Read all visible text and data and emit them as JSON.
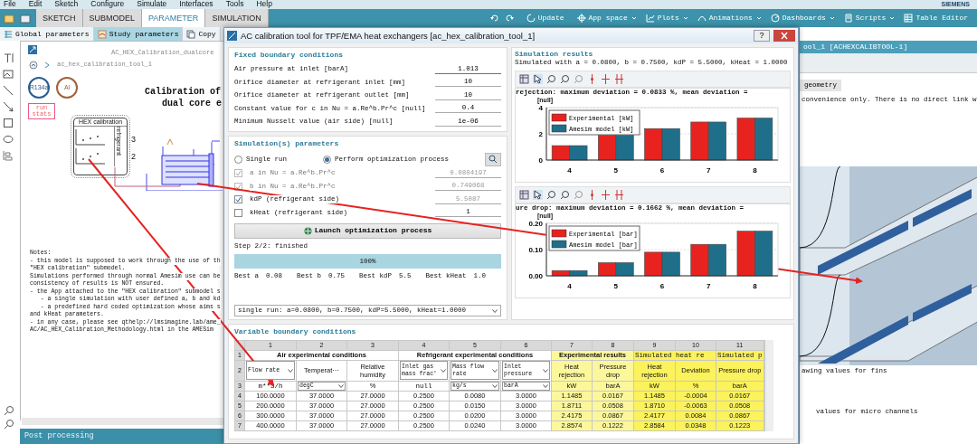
{
  "menu": [
    "File",
    "Edit",
    "Sketch",
    "Configure",
    "Simulate",
    "Interfaces",
    "Tools",
    "Help"
  ],
  "brand": "SIEMENS",
  "toolbar": {
    "tabs": [
      {
        "label": "SKETCH",
        "selected": false
      },
      {
        "label": "SUBMODEL",
        "selected": false
      },
      {
        "label": "PARAMETER",
        "selected": true
      },
      {
        "label": "SIMULATION",
        "selected": false
      }
    ],
    "actions": [
      {
        "label": "Update",
        "kind": "update"
      },
      {
        "label": "App space",
        "kind": "app"
      },
      {
        "label": "Plots",
        "kind": "plots"
      },
      {
        "label": "Animations",
        "kind": "anim"
      },
      {
        "label": "Dashboards",
        "kind": "dash"
      },
      {
        "label": "Scripts",
        "kind": "scripts"
      },
      {
        "label": "Table Editor",
        "kind": "table"
      }
    ]
  },
  "left_panel": {
    "tabs": [
      {
        "label": "Global parameters",
        "selected": false
      },
      {
        "label": "Study parameters",
        "selected": true
      },
      {
        "label": "Copy",
        "selected": false
      }
    ],
    "sketch_title": "AC_HEX_Calibration_dualcore",
    "breadcrumb": "ac_hex_calibration_tool_1",
    "badges": [
      {
        "label": "R134a",
        "color": "#2a5d8f"
      },
      {
        "label": "Al",
        "color": "#a0623a"
      }
    ],
    "run_stats": "run stats",
    "diagram_title": [
      "Calibration of",
      "dual core e"
    ],
    "block": {
      "title": "HEX calibration",
      "side_label": "refrigerant",
      "ports": [
        "3",
        "2"
      ]
    },
    "notes": [
      "Notes:",
      "- this model is supposed to work through the use of th",
      "\"HEX calibration\" submodel.",
      "Simulations performed through normal Amesim use can be",
      "consistency of results is NOT ensured.",
      "- the App attached to the \"HEX calibration\" submodel s",
      "   - a single simulation with user defined a, b and kd",
      "   - a predefined hard coded optimization whose aims s",
      "and kHeat parameters.",
      "- in any case, please see qthelp://lmsimagine.lab/ame_",
      "AC/AC_HEX_Calibration_Methodology.html in the AMESim"
    ],
    "bottom_bar": "Post processing"
  },
  "dialog": {
    "title": "AC calibration tool for TPF/EMA heat exchangers [ac_hex_calibration_tool_1]",
    "help": "?",
    "fixed": {
      "heading": "Fixed boundary conditions",
      "rows": [
        {
          "label": "Air pressure at inlet [barA]",
          "value": "1.013"
        },
        {
          "label": "Orifice diameter at refrigerant inlet [mm]",
          "value": "10"
        },
        {
          "label": "Orifice diameter at refrigerant outlet [mm]",
          "value": "10"
        },
        {
          "label": "Constant value for c in Nu = a.Re^b.Pr^c [null]",
          "value": "0.4"
        },
        {
          "label": "Minimum Nusselt value (air side) [null]",
          "value": "1e-06"
        }
      ]
    },
    "simulation": {
      "heading": "Simulation(s) parameters",
      "modes": [
        {
          "label": "Single run",
          "selected": false
        },
        {
          "label": "Perform optimization process",
          "selected": true
        }
      ],
      "params": [
        {
          "label": "a in Nu = a.Re^b.Pr^c",
          "checked": true,
          "disabled": true,
          "value": "0.0804197"
        },
        {
          "label": "b in Nu = a.Re^b.Pr^c",
          "checked": true,
          "disabled": true,
          "value": "0.749068"
        },
        {
          "label": "kdP (refrigerant side)",
          "checked": true,
          "disabled": false,
          "value": "5.5087"
        },
        {
          "label": "kHeat (refrigerant side)",
          "checked": false,
          "disabled": false,
          "value": "1"
        }
      ],
      "launch": "Launch optimization process",
      "status": "Step 2/2: finished",
      "progress": {
        "level": 1,
        "text": "100%"
      },
      "best": [
        {
          "label": "Best a",
          "value": "0.08"
        },
        {
          "label": "Best b",
          "value": "0.75"
        },
        {
          "label": "Best kdP",
          "value": "5.5"
        },
        {
          "label": "Best kHeat",
          "value": "1.0"
        }
      ],
      "run_select": "single run: a=0.0800, b=0.7500, kdP=5.5000, kHeat=1.0000"
    },
    "results": {
      "heading": "Simulation results",
      "subtitle": "Simulated with a = 0.0800, b = 0.7500, kdP = 5.5000, kHeat = 1.0000",
      "charts": [
        {
          "chart_data": {
            "type": "bar",
            "title": "rejection: maximum deviation = 0.0833 %, mean deviation =",
            "ylabel": "[null]",
            "categories": [
              "4",
              "5",
              "6",
              "7",
              "8"
            ],
            "legend": "upper left",
            "series": [
              {
                "name": "Experimental [kW]",
                "color": "#e8231f",
                "values": [
                  1.1,
                  1.9,
                  2.4,
                  2.9,
                  3.2
                ]
              },
              {
                "name": "Amesim model [kW]",
                "color": "#1f6f8b",
                "values": [
                  1.1,
                  1.9,
                  2.4,
                  2.9,
                  3.2
                ]
              }
            ],
            "ylim": [
              0,
              4
            ],
            "yticks": [
              0,
              2,
              4
            ]
          }
        },
        {
          "chart_data": {
            "type": "bar",
            "title": "ure drop: maximum deviation = 0.1662 %, mean deviation =",
            "ylabel": "[null]",
            "categories": [
              "4",
              "5",
              "6",
              "7",
              "8"
            ],
            "legend": "upper left",
            "series": [
              {
                "name": "Experimental [bar]",
                "color": "#e8231f",
                "values": [
                  0.02,
                  0.05,
                  0.09,
                  0.12,
                  0.17
                ]
              },
              {
                "name": "Amesim model [bar]",
                "color": "#1f6f8b",
                "values": [
                  0.02,
                  0.05,
                  0.09,
                  0.12,
                  0.17
                ]
              }
            ],
            "ylim": [
              0,
              0.2
            ],
            "yticks": [
              {
                "value": 0,
                "label": "0.00"
              },
              {
                "value": 0.1,
                "label": "0.10"
              },
              {
                "value": 0.2,
                "label": "0.20"
              }
            ]
          }
        }
      ]
    },
    "variable": {
      "heading": "Variable boundary conditions",
      "column_numbers": [
        "1",
        "2",
        "3",
        "4",
        "5",
        "6",
        "7",
        "8",
        "9",
        "10",
        "11"
      ],
      "row_numbers": [
        "1",
        "2",
        "3",
        "4",
        "5",
        "6",
        "7"
      ],
      "groups": [
        {
          "label": "Air experimental conditions",
          "kind": "input",
          "columns": [
            {
              "name": "Flow rate",
              "dropdown": true,
              "unit": "m**3/h",
              "unit_dropdown": false
            },
            {
              "name": "Temperat···",
              "dropdown": false,
              "unit": "degC",
              "unit_dropdown": true
            },
            {
              "name": "Relative humidity",
              "dropdown": false,
              "unit": "%",
              "unit_dropdown": false
            }
          ]
        },
        {
          "label": "Refrigerant experimental conditions",
          "kind": "input",
          "columns": [
            {
              "name": "Inlet gas mass frac'",
              "dropdown": true,
              "unit": "null",
              "unit_dropdown": false
            },
            {
              "name": "Mass flow rate",
              "dropdown": true,
              "unit": "kg/s",
              "unit_dropdown": true
            },
            {
              "name": "Inlet pressure",
              "dropdown": true,
              "unit": "barA",
              "unit_dropdown": true
            }
          ]
        },
        {
          "label": "Experimental results",
          "kind": "result",
          "columns": [
            {
              "name": "Heat rejection",
              "dropdown": false,
              "unit": "kW",
              "unit_dropdown": false
            },
            {
              "name": "Pressure drop",
              "dropdown": false,
              "unit": "barA",
              "unit_dropdown": false
            }
          ]
        },
        {
          "label": "Simulated heat re",
          "kind": "simulated",
          "columns": [
            {
              "name": "Heat rejection",
              "dropdown": false,
              "unit": "kW",
              "unit_dropdown": false
            },
            {
              "name": "Deviation",
              "dropdown": false,
              "unit": "%",
              "unit_dropdown": false
            }
          ]
        },
        {
          "label": "Simulated p",
          "kind": "simulated",
          "columns": [
            {
              "name": "Pressure drop",
              "dropdown": false,
              "unit": "barA",
              "unit_dropdown": false
            }
          ]
        }
      ],
      "rows": [
        [
          "100.0000",
          "37.0000",
          "27.0000",
          "0.2500",
          "0.0080",
          "3.0000",
          "1.1485",
          "0.0167",
          "1.1485",
          "-0.0004",
          "0.0167"
        ],
        [
          "200.0000",
          "37.0000",
          "27.0000",
          "0.2500",
          "0.0150",
          "3.0000",
          "1.8711",
          "0.0508",
          "1.8710",
          "-0.0063",
          "0.0508"
        ],
        [
          "300.0000",
          "37.0000",
          "27.0000",
          "0.2500",
          "0.0200",
          "3.0000",
          "2.4175",
          "0.0867",
          "2.4177",
          "0.0084",
          "0.0867"
        ],
        [
          "400.0000",
          "37.0000",
          "27.0000",
          "0.2500",
          "0.0240",
          "3.0000",
          "2.8574",
          "0.1222",
          "2.8584",
          "0.0348",
          "0.1223"
        ]
      ]
    }
  },
  "background_window": {
    "title": "ool_1 [ACHEXCALIBTOOL-1]",
    "tab": "geometry",
    "text": "convenience only. There is no direct link w",
    "captions": [
      "awing values for fins",
      "values for micro channels"
    ]
  }
}
